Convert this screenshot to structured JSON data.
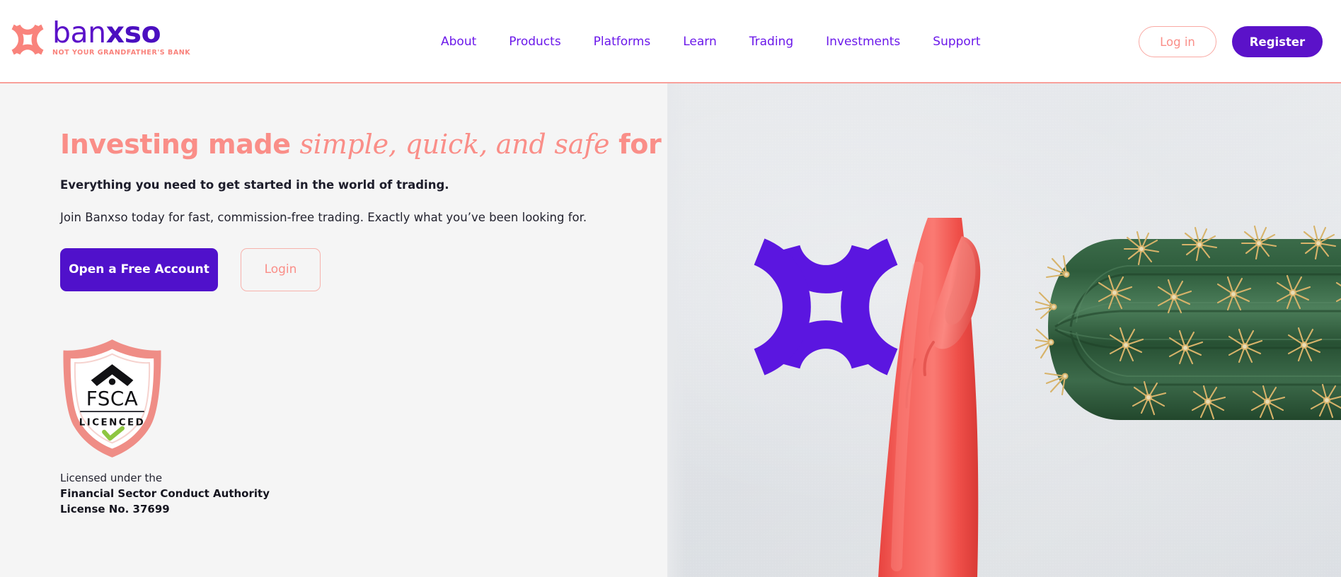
{
  "brand": {
    "logo_word_light": "ban",
    "logo_word_bold": "xso",
    "tagline": "NOT YOUR GRANDFATHER'S BANK",
    "mark_color": "#f9837c",
    "word_color": "#5b12c9"
  },
  "header": {
    "nav": [
      {
        "label": "About"
      },
      {
        "label": "Products"
      },
      {
        "label": "Platforms"
      },
      {
        "label": "Learn"
      },
      {
        "label": "Trading"
      },
      {
        "label": "Investments"
      },
      {
        "label": "Support"
      }
    ],
    "login_label": "Log in",
    "register_label": "Register",
    "nav_color": "#6b18ea",
    "register_bg": "#5b12c9",
    "login_border": "#f9a9a3",
    "border_bottom_color": "#f8a09a"
  },
  "hero": {
    "headline_part1": "Investing made ",
    "headline_italic": "simple, quick, and safe",
    "headline_part2": " for all.",
    "headline_color": "#fa8e88",
    "subheading": "Everything you need to get started in the world of trading.",
    "body": "Join Banxso today for fast, commission-free trading. Exactly what you’ve been looking for.",
    "primary_cta": "Open a Free Account",
    "secondary_cta": "Login",
    "primary_cta_bg": "#5011cb",
    "background": "#f5f5f5"
  },
  "badge": {
    "acronym": "FSCA",
    "status": "LICENCED",
    "shield_color": "#ef8d86",
    "check_color": "#8ec641"
  },
  "license": {
    "line1": "Licensed under the",
    "line2": "Financial Sector Conduct Authority",
    "line3": "License No. 37699"
  },
  "hero_image": {
    "x_mark_color": "#5b16e0",
    "glove_color": "#f2544f",
    "cactus_color": "#2f5b3c",
    "spine_color": "#d7b36a",
    "background": "#e3e6e9"
  }
}
